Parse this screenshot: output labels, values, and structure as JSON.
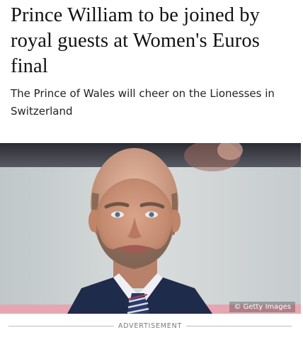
{
  "article": {
    "headline": "Prince William to be joined by royal guests at Women's Euros final",
    "standfirst": "The Prince of Wales will cheer on the Lionesses in Switzerland",
    "image": {
      "credit": "© Getty Images"
    },
    "advertisement_label": "ADVERTISEMENT"
  }
}
